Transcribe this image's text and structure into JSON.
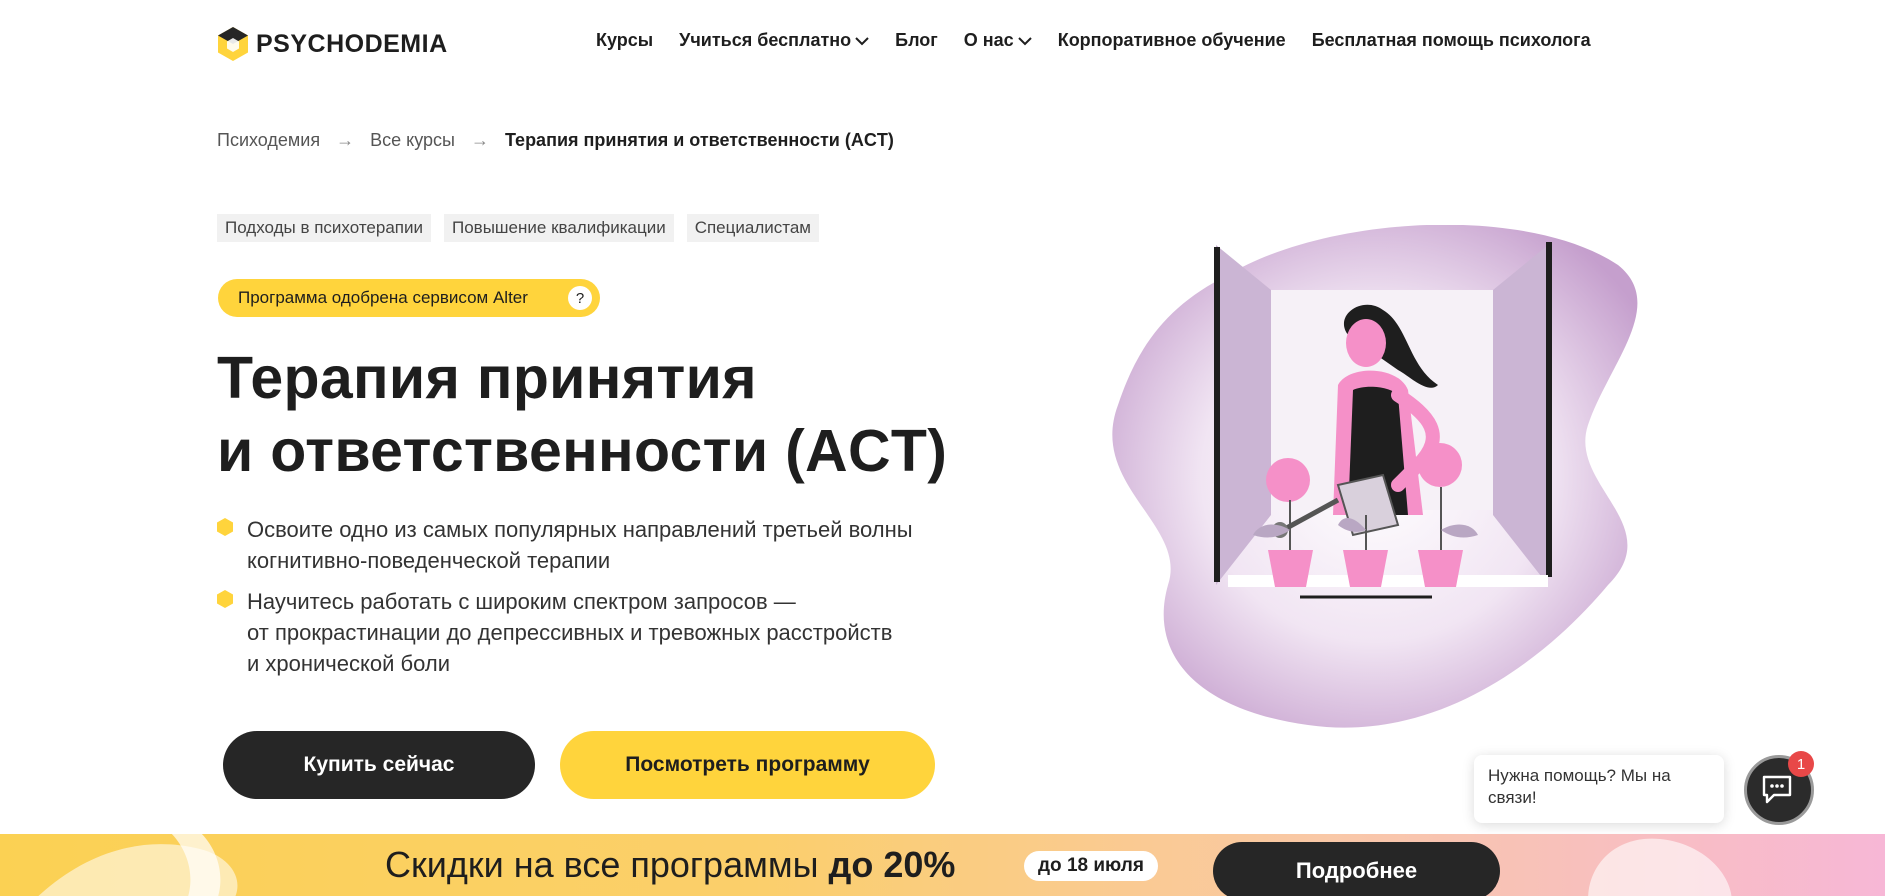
{
  "header": {
    "logo_text": "PSYCHODEMIA",
    "nav": [
      {
        "label": "Курсы",
        "icon": ""
      },
      {
        "label": "Учиться бесплатно",
        "icon": "chevron-down-icon"
      },
      {
        "label": "Блог",
        "icon": ""
      },
      {
        "label": "О нас",
        "icon": "chevron-down-icon"
      },
      {
        "label": "Корпоративное обучение",
        "icon": ""
      },
      {
        "label": "Бесплатная помощь психолога",
        "icon": ""
      }
    ]
  },
  "breadcrumb": {
    "items": [
      "Психодемия",
      "Все курсы"
    ],
    "current": "Терапия принятия и ответственности (ACT)",
    "separator": "→"
  },
  "tags": [
    "Подходы в психотерапии",
    "Повышение квалификации",
    "Специалистам"
  ],
  "badge": {
    "text": "Программа одобрена сервисом Alter",
    "help": "?"
  },
  "title": {
    "line1": "Терапия принятия",
    "line2": "и ответственности (ACT)"
  },
  "bullets": [
    {
      "lines": [
        "Освоите одно из самых популярных направлений третьей волны",
        "когнитивно-поведенческой терапии"
      ]
    },
    {
      "lines": [
        "Научитесь работать с широким спектром запросов —",
        "от прокрастинации до депрессивных и тревожных расстройств",
        "и хронической боли"
      ]
    }
  ],
  "buttons": {
    "buy": "Купить сейчас",
    "program": "Посмотреть программу"
  },
  "chat": {
    "text": "Нужна помощь? Мы на связи!",
    "count": "1",
    "icon": "chat-icon"
  },
  "promo": {
    "text": "Скидки на все программы",
    "discount": "до 20%",
    "date": "до 18 июля",
    "button": "Подробнее"
  },
  "colors": {
    "accent": "#ffd43c",
    "dark": "#262626",
    "pink": "#f590c8",
    "lilac": "#d4bfdc"
  }
}
